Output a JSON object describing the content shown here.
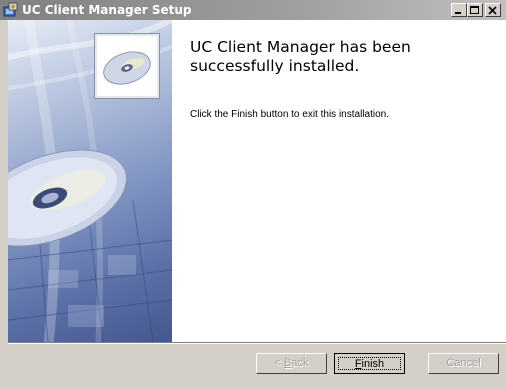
{
  "window": {
    "title": "UC Client Manager Setup",
    "controls": {
      "minimize": "minimize-icon",
      "maximize": "maximize-icon",
      "close": "close-icon"
    }
  },
  "banner": {
    "graphic": "cd-disc-icon"
  },
  "content": {
    "heading_line1": "UC Client Manager has been",
    "heading_line2": "successfully installed.",
    "body": "Click the Finish button to exit this installation."
  },
  "buttons": {
    "back": {
      "prefix": "< ",
      "accel": "B",
      "rest": "ack",
      "enabled": false
    },
    "finish": {
      "accel": "F",
      "rest": "inish",
      "enabled": true
    },
    "cancel": {
      "label": "Cancel",
      "enabled": false
    }
  },
  "colors": {
    "dialog_bg": "#d4d0c8",
    "titlebar": "#808080",
    "banner_blue": "#5a6fa6"
  }
}
